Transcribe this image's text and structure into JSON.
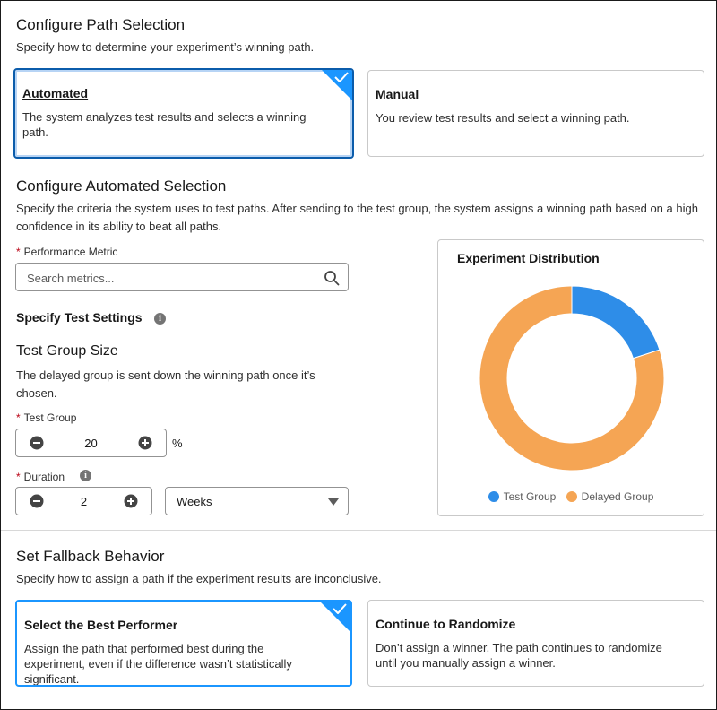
{
  "path_selection": {
    "title": "Configure Path Selection",
    "description": "Specify how to determine your experiment’s winning path.",
    "options": [
      {
        "title": "Automated",
        "body": "The system analyzes test results and selects a winning path.",
        "selected": true
      },
      {
        "title": "Manual",
        "body": "You review test results and select a winning path.",
        "selected": false
      }
    ]
  },
  "automated_selection": {
    "title": "Configure Automated Selection",
    "description": "Specify the criteria the system uses to test paths. After sending to the test group, the system assigns a winning path based on a high confidence in its ability to beat all paths.",
    "metric_label": "Performance Metric",
    "metric_placeholder": "Search metrics...",
    "required_mark": "*"
  },
  "test_settings": {
    "title": "Specify Test Settings",
    "info_glyph": "i",
    "group_size_title": "Test Group Size",
    "group_size_desc": "The delayed group is sent down the winning path once it’s chosen.",
    "test_group_label": "Test Group",
    "test_group_value": "20",
    "test_group_unit": "%",
    "duration_label": "Duration",
    "duration_value": "2",
    "duration_unit": "Weeks"
  },
  "chart_panel": {
    "title": "Experiment Distribution"
  },
  "chart_data": {
    "type": "pie",
    "title": "Experiment Distribution",
    "donut": true,
    "categories": [
      "Test Group",
      "Delayed Group"
    ],
    "values": [
      20,
      80
    ],
    "colors": [
      "#2e8de8",
      "#f5a554"
    ],
    "legend": "bottom"
  },
  "fallback": {
    "title": "Set Fallback Behavior",
    "description": "Specify how to assign a path if the experiment results are inconclusive.",
    "options": [
      {
        "title": "Select the Best Performer",
        "body": "Assign the path that performed best during the experiment, even if the difference wasn’t statistically significant.",
        "selected": true
      },
      {
        "title": "Continue to Randomize",
        "body": "Don’t assign a winner. The path continues to randomize until you manually assign a winner.",
        "selected": false
      }
    ]
  },
  "colors": {
    "brand_blue": "#1b96ff",
    "selected_border": "#0b5cab",
    "required_red": "#ba0517"
  }
}
